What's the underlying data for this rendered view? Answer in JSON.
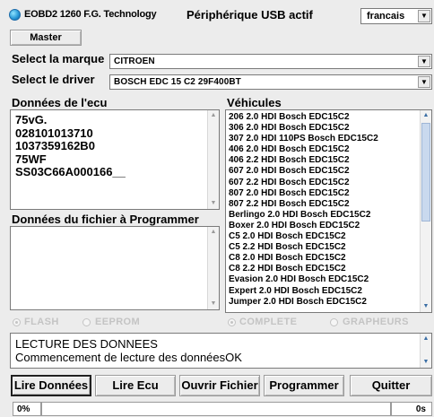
{
  "header": {
    "app_title": "EOBD2 1260 F.G. Technology",
    "usb_status": "Périphérique USB actif",
    "language": "francais",
    "master_label": "Master"
  },
  "selectors": {
    "marque_label": "Select la marque",
    "marque_value": "CITROEN",
    "driver_label": "Select le driver",
    "driver_value": "BOSCH EDC 15 C2 29F400BT"
  },
  "ecu": {
    "title": "Données de l'ecu",
    "lines": [
      "75vG.",
      "028101013710",
      "1037359162B0",
      "75WF",
      "SS03C66A000166__"
    ]
  },
  "file": {
    "title": "Données du fichier à Programmer"
  },
  "vehicles": {
    "title": "Véhicules",
    "items": [
      "206 2.0 HDI Bosch EDC15C2",
      "306 2.0 HDI Bosch EDC15C2",
      "307 2.0 HDI 110PS Bosch EDC15C2",
      "406 2.0 HDI Bosch EDC15C2",
      "406 2.2 HDI Bosch EDC15C2",
      "607 2.0 HDI Bosch EDC15C2",
      "607 2.2 HDI Bosch EDC15C2",
      "807 2.0 HDI Bosch EDC15C2",
      "807 2.2 HDI Bosch EDC15C2",
      "Berlingo 2.0 HDI Bosch EDC15C2",
      "Boxer 2.0 HDI Bosch EDC15C2",
      "C5 2.0 HDI Bosch EDC15C2",
      "C5 2.2 HDI Bosch EDC15C2",
      "C8 2.0 HDI Bosch EDC15C2",
      "C8 2.2 HDI Bosch EDC15C2",
      "Evasion 2.0 HDI Bosch EDC15C2",
      "Expert 2.0 HDI Bosch EDC15C2",
      "Jumper 2.0 HDI Bosch EDC15C2"
    ]
  },
  "options": {
    "flash": "FLASH",
    "eeprom": "EEPROM",
    "complete": "COMPLETE",
    "grapheurs": "GRAPHEURS"
  },
  "log": {
    "lines": [
      "LECTURE DES DONNEES",
      "Commencement de lecture des donnéesOK"
    ]
  },
  "buttons": {
    "lire_donnees": "Lire Données",
    "lire_ecu": "Lire Ecu",
    "ouvrir_fichier": "Ouvrir Fichier",
    "programmer": "Programmer",
    "quitter": "Quitter"
  },
  "status": {
    "progress": "0%",
    "time": "0s"
  },
  "icons": {
    "app": "app-globe-icon",
    "dropdown": "chevron-down-icon",
    "scroll_up": "arrow-up-icon",
    "scroll_down": "arrow-down-icon"
  }
}
